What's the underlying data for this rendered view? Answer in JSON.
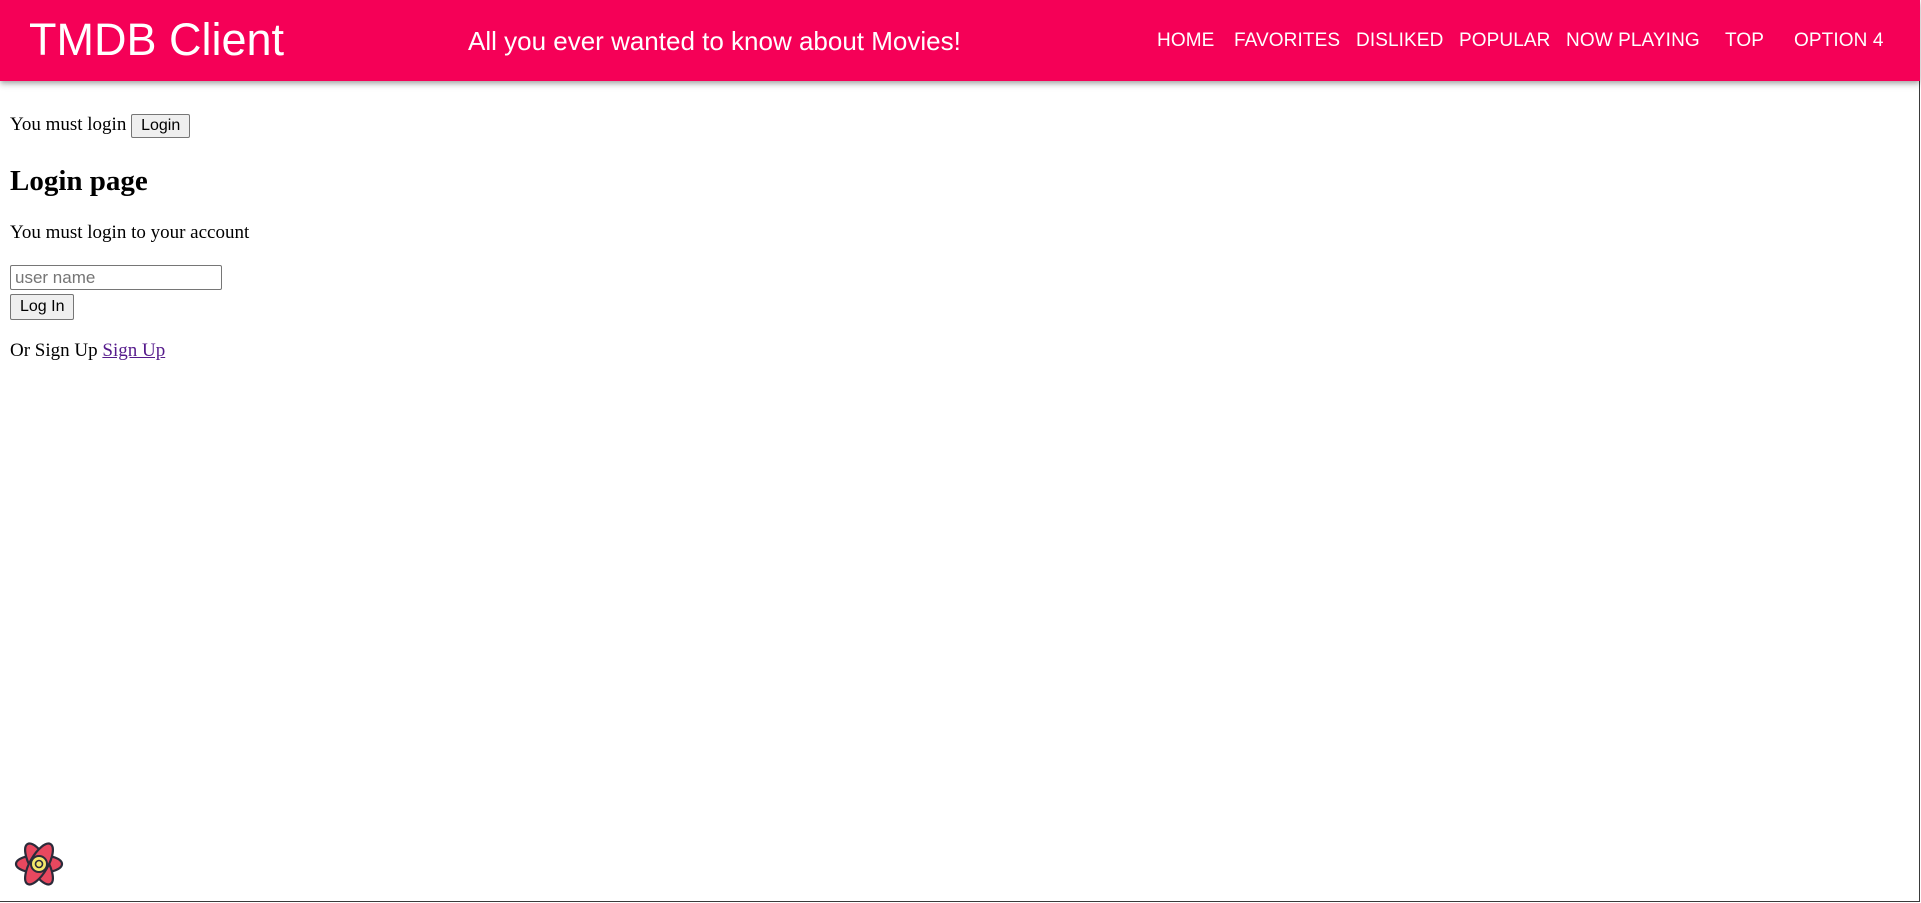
{
  "header": {
    "brand": "TMDB Client",
    "tagline": "All you ever wanted to know about Movies!",
    "nav": [
      "HOME",
      "FAVORITES",
      "DISLIKED",
      "POPULAR",
      "NOW PLAYING",
      "TOP",
      "OPTION 4"
    ],
    "background_color": "#f50057"
  },
  "main": {
    "must_login_text": "You must login",
    "login_button": "Login",
    "heading": "Login page",
    "subtext": "You must login to your account",
    "username_placeholder": "user name",
    "login_submit": "Log In",
    "signup_prefix": "Or Sign Up",
    "signup_link": "Sign Up"
  },
  "footer": {
    "devtools_icon": "react-icon"
  }
}
